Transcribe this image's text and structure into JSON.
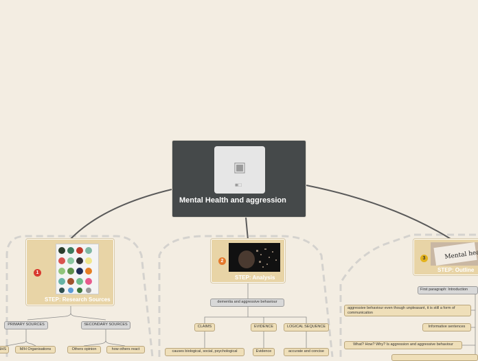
{
  "central": {
    "title": "Mental Health and aggression",
    "image_icon": "camera-icon"
  },
  "steps": [
    {
      "badge": "1",
      "badge_color": "#d8392f",
      "label": "STEP: Research Sources"
    },
    {
      "badge": "2",
      "badge_color": "#e4782b",
      "label": "STEP: Analysis"
    },
    {
      "badge": "3",
      "badge_color": "#e3b21c",
      "label": "STEP: Outline"
    }
  ],
  "research": {
    "primary": "PRIMARY SOURCES",
    "secondary": "SECONDARY SOURCES",
    "partial": "NHS",
    "mh_org": "M/H Organisations",
    "others_opinion": "Others opinion",
    "how_others": "how others react"
  },
  "analysis": {
    "topic": "dementia and aggressive behaviour",
    "claims": "CLAIMS",
    "evidence": "EVIDENCE",
    "logical": "LOGICAL SEQUENCE",
    "causes": "causes biological, social, psychological",
    "evidence_child": "Evidence",
    "accurate": "accurate and concise"
  },
  "outline": {
    "first_paragraph": "First paragraph: Introduction",
    "aggressive_text": "aggressive behaviour even though unpleasant, it is still a form of communication",
    "informative": "Informative sentences",
    "what_how_why": "What? How? Why? Is aggression and aggressive behaviour",
    "image_caption": "Mental health"
  },
  "colors": {
    "background": "#f3ede2",
    "central": "#45494a",
    "step": "#e8d4a6",
    "connector": "#5a5a5a"
  }
}
